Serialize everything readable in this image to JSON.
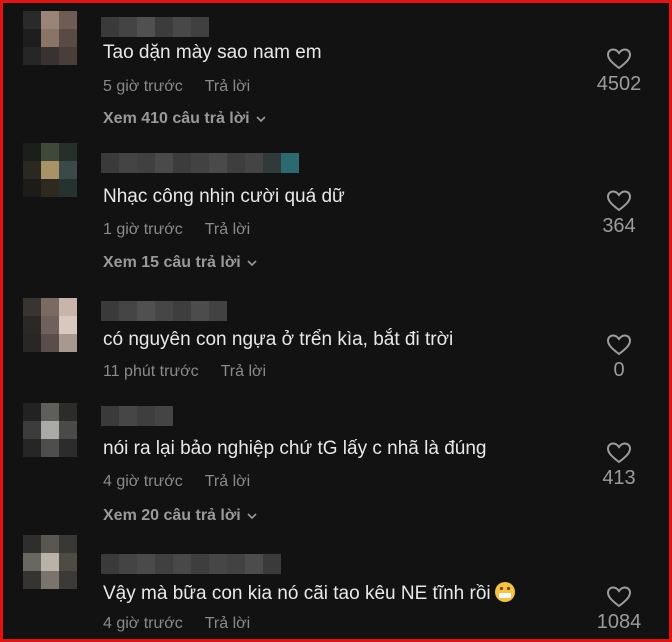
{
  "comments": [
    {
      "text": "Tao dặn mày sao nam em",
      "time": "5 giờ trước",
      "reply": "Trả lời",
      "likes": "4502",
      "view_replies": "Xem 410 câu trả lời",
      "avatar_colors": [
        "#2a2a2a",
        "#9a8478",
        "#6f5d55",
        "#1e1e1e",
        "#8a7466",
        "#5a4a44",
        "#262626",
        "#3a3230",
        "#4a3e3a"
      ],
      "name_colors": [
        "#3a3a3a",
        "#444444",
        "#505050",
        "#3c3c3c",
        "#484848",
        "#404040"
      ]
    },
    {
      "text": "Nhạc công nhịn cười quá dữ",
      "time": "1 giờ trước",
      "reply": "Trả lời",
      "likes": "364",
      "view_replies": "Xem 15 câu trả lời",
      "avatar_colors": [
        "#1a1f1a",
        "#3d4a3a",
        "#26302b",
        "#2a2820",
        "#a89266",
        "#3b4a48",
        "#1d1c18",
        "#2f2a20",
        "#263230"
      ],
      "name_colors": [
        "#3a3a3a",
        "#444444",
        "#404040",
        "#4a4a4a",
        "#3c3c3c",
        "#424242",
        "#4a4a4a",
        "#3e3e3e",
        "#444444",
        "#303a3a",
        "#2a6a70"
      ]
    },
    {
      "text": "có nguyên con ngựa ở trển kìa, bắt đi trời",
      "time": "11 phút trước",
      "reply": "Trả lời",
      "likes": "0",
      "view_replies": "",
      "avatar_colors": [
        "#3a3430",
        "#7a6a62",
        "#c8b4a8",
        "#2c2826",
        "#6e605a",
        "#d8c8c0",
        "#2a2624",
        "#5a4e4a",
        "#a89890"
      ],
      "name_colors": [
        "#3a3a3a",
        "#454545",
        "#505050",
        "#464646",
        "#3e3e3e",
        "#4c4c4c",
        "#424242"
      ]
    },
    {
      "text": "nói ra lại bảo nghiệp chứ tG lấy c nhã là đúng",
      "time": "4 giờ trước",
      "reply": "Trả lời",
      "likes": "413",
      "view_replies": "Xem 20 câu trả lời",
      "avatar_colors": [
        "#222222",
        "#5e5e5a",
        "#2c2c2a",
        "#3c3c3a",
        "#aaaaa6",
        "#4a4a48",
        "#262626",
        "#4e4e4c",
        "#2c2c2c"
      ],
      "name_colors": [
        "#3a3a3a",
        "#464646",
        "#3e3e3e",
        "#444444"
      ]
    },
    {
      "text": "Vậy mà bữa con kia nó cãi tao kêu NE tĩnh rồi",
      "time": "4 giờ trước",
      "reply": "Trả lời",
      "likes": "1084",
      "view_replies": "",
      "avatar_colors": [
        "#2e2e2c",
        "#5a5650",
        "#3a3834",
        "#6a6660",
        "#b8b2a8",
        "#4e4a44",
        "#363430",
        "#7a746c",
        "#3c3a36"
      ],
      "name_colors": [
        "#3a3a3a",
        "#444444",
        "#4a4a4a",
        "#404040",
        "#484848",
        "#3e3e3e",
        "#464646",
        "#424242",
        "#4c4c4c",
        "#3a3a3a"
      ]
    }
  ],
  "icons": {
    "like": "heart-outline-icon",
    "expand": "chevron-down-icon",
    "emoji": "grinning-face-emoji"
  },
  "colors": {
    "frame_border": "#e3140f",
    "background": "#121212",
    "text": "#e8e8e8",
    "muted": "#8a8a8a"
  }
}
